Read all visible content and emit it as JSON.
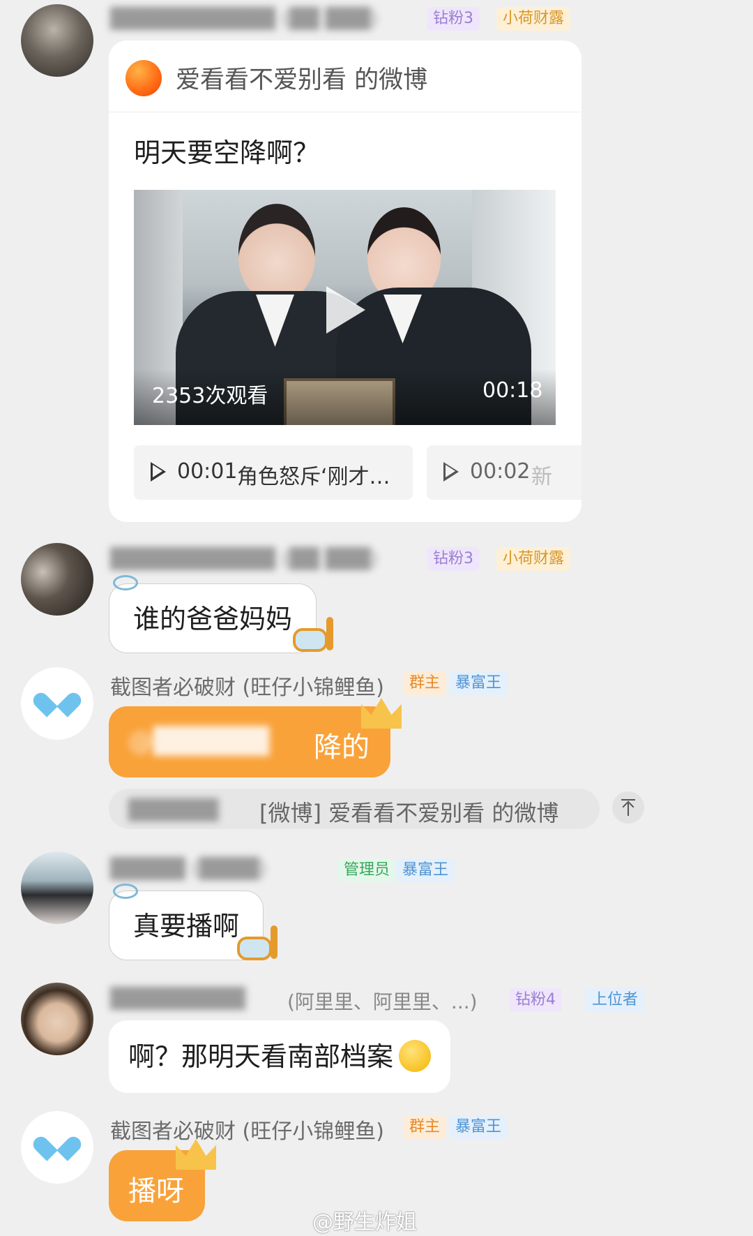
{
  "msg1": {
    "badges": [
      "钻粉3",
      "小荷财露"
    ],
    "card": {
      "source": "爱看看不爱别看 的微博",
      "title": "明天要空降啊？",
      "views": "2353次观看",
      "duration": "00:18",
      "chapters": [
        {
          "time": "00:01",
          "label": "角色怒斥‘刚才…"
        },
        {
          "time": "00:02",
          "label": "新"
        }
      ]
    }
  },
  "msg2": {
    "badges": [
      "钻粉3",
      "小荷财露"
    ],
    "text": "谁的爸爸妈妈"
  },
  "msg3": {
    "name": "截图者必破财 (旺仔小锦鲤鱼)",
    "badges": [
      "群主",
      "暴富王"
    ],
    "text": "降的",
    "quote": "[微博] 爱看看不爱别看 的微博"
  },
  "msg4": {
    "badges": [
      "管理员",
      "暴富王"
    ],
    "text": "真要播啊"
  },
  "msg5": {
    "name_tail": "(阿里里、阿里里、...)",
    "badges": [
      "钻粉4",
      "上位者"
    ],
    "text": "啊？那明天看南部档案"
  },
  "msg6": {
    "name": "截图者必破财 (旺仔小锦鲤鱼)",
    "badges": [
      "群主",
      "暴富王"
    ],
    "text": "播呀"
  },
  "watermark": "@野生炸姐",
  "colors": {
    "accent_orange": "#f9a23a",
    "bg": "#efefef"
  }
}
